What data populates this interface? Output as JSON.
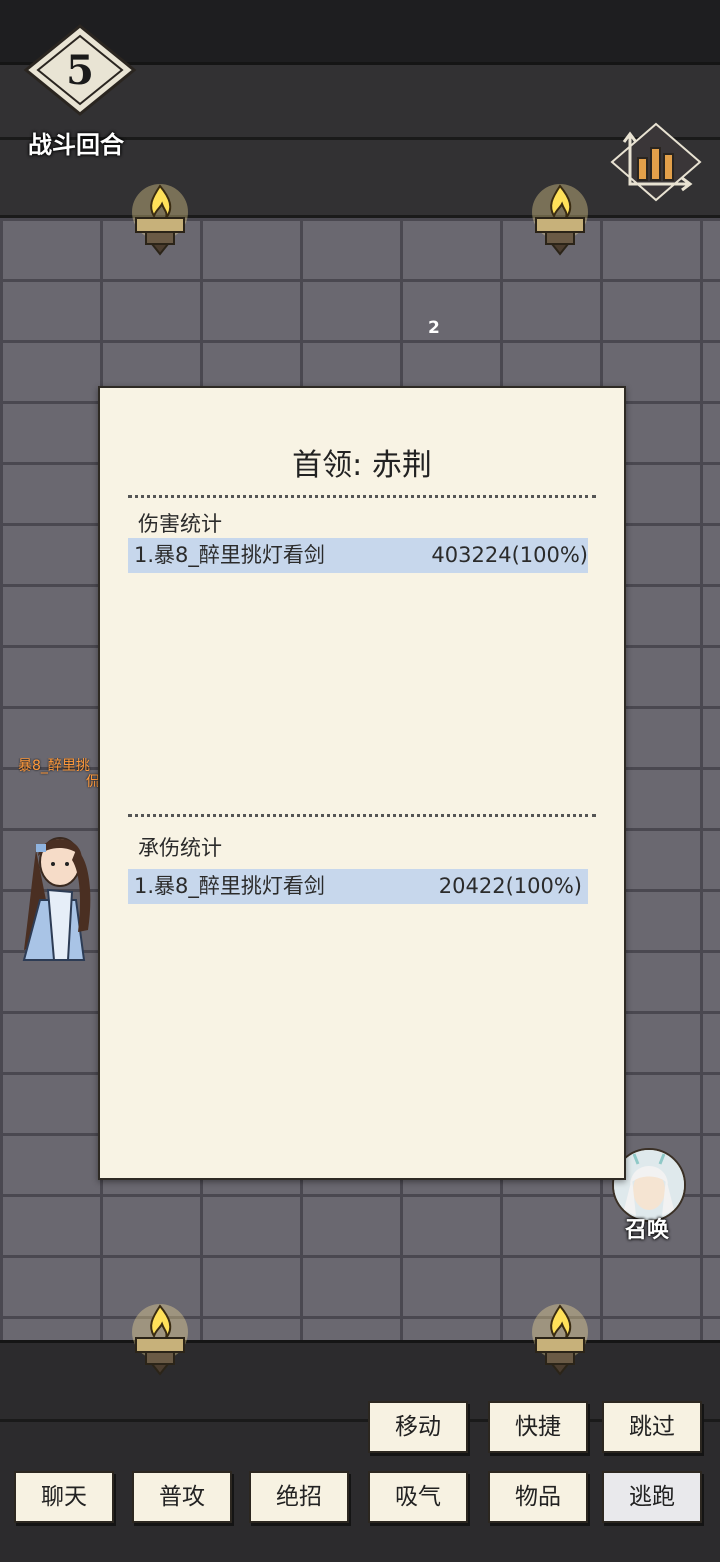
{
  "round": {
    "number": "5",
    "label": "战斗回合"
  },
  "enemy_count": "2",
  "player": {
    "name_line1": "暴8_醉里挑",
    "name_line2": "侃"
  },
  "summon": {
    "label": "召唤"
  },
  "panel": {
    "title": "首领: 赤荆",
    "damage": {
      "title": "伤害统计",
      "rows": [
        {
          "name": "1.暴8_醉里挑灯看剑",
          "value": "403224(100%)"
        }
      ]
    },
    "taken": {
      "title": "承伤统计",
      "rows": [
        {
          "name": "1.暴8_醉里挑灯看剑",
          "value": "20422(100%)"
        }
      ]
    }
  },
  "buttons": {
    "move": "移动",
    "quick": "快捷",
    "skip": "跳过",
    "chat": "聊天",
    "attack": "普攻",
    "ultimate": "绝招",
    "breathe": "吸气",
    "items": "物品",
    "escape": "逃跑"
  },
  "colors": {
    "highlight_row": "#c7d7ec",
    "panel_bg": "#f8f3e4",
    "name_color": "#ff9a3c"
  }
}
